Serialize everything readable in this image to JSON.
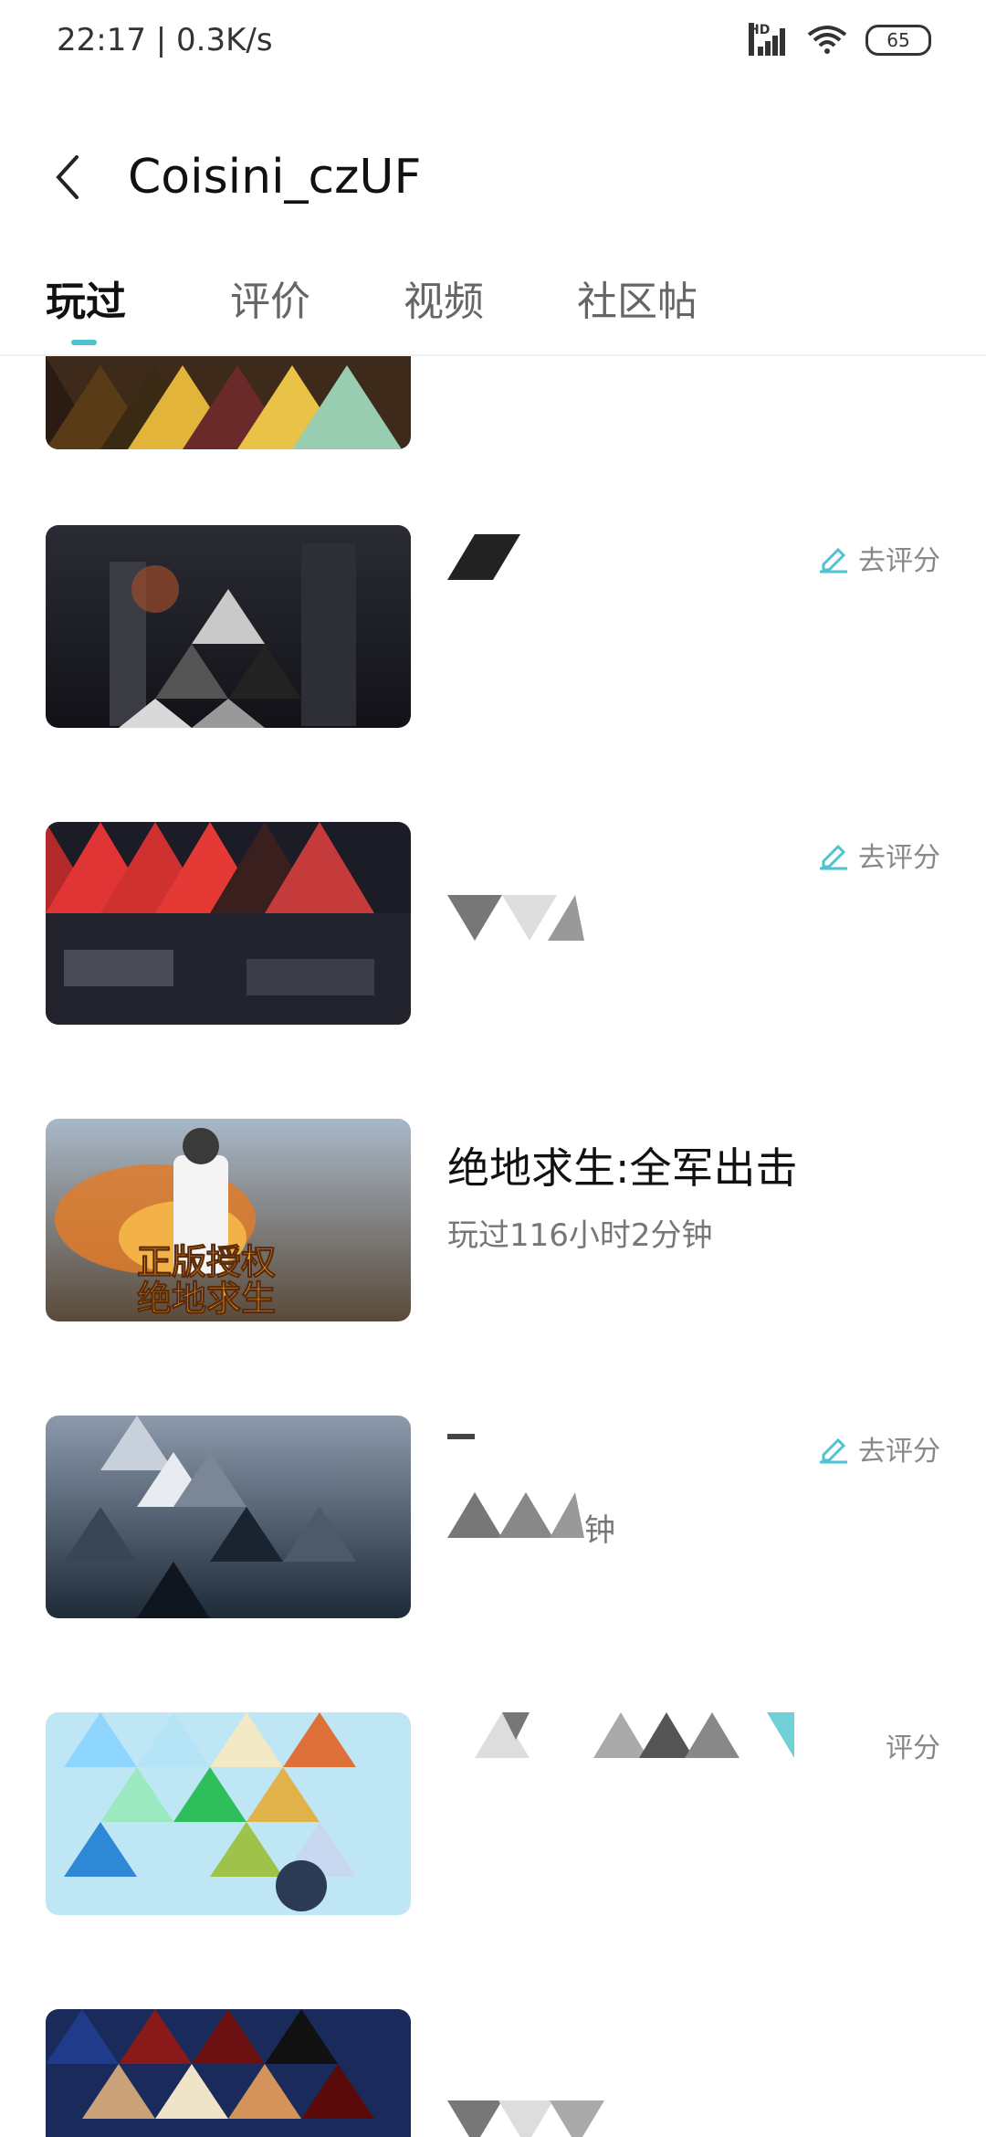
{
  "status_bar": {
    "time": "22:17 | 0.3K/s",
    "signal_label": "HD",
    "battery": "65"
  },
  "header": {
    "title": "Coisini_czUF"
  },
  "tabs": [
    {
      "label": "玩过",
      "active": true
    },
    {
      "label": "评价",
      "active": false
    },
    {
      "label": "视频",
      "active": false
    },
    {
      "label": "社区帖",
      "active": false
    }
  ],
  "items": [
    {
      "title": "",
      "subtitle": "",
      "rate_label": ""
    },
    {
      "title": "",
      "subtitle": "",
      "rate_label": "去评分"
    },
    {
      "title": "",
      "subtitle": "",
      "rate_label": "去评分"
    },
    {
      "title": "绝地求生:全军出击",
      "subtitle": "玩过116小时2分钟",
      "rate_label": ""
    },
    {
      "title": "",
      "subtitle": "钟",
      "rate_label": "去评分"
    },
    {
      "title": "",
      "subtitle": "",
      "rate_label": "评分"
    },
    {
      "title": "",
      "subtitle": "",
      "rate_label": ""
    }
  ],
  "colors": {
    "accent": "#4fc3d1",
    "text_primary": "#111111",
    "text_secondary": "#777777"
  }
}
